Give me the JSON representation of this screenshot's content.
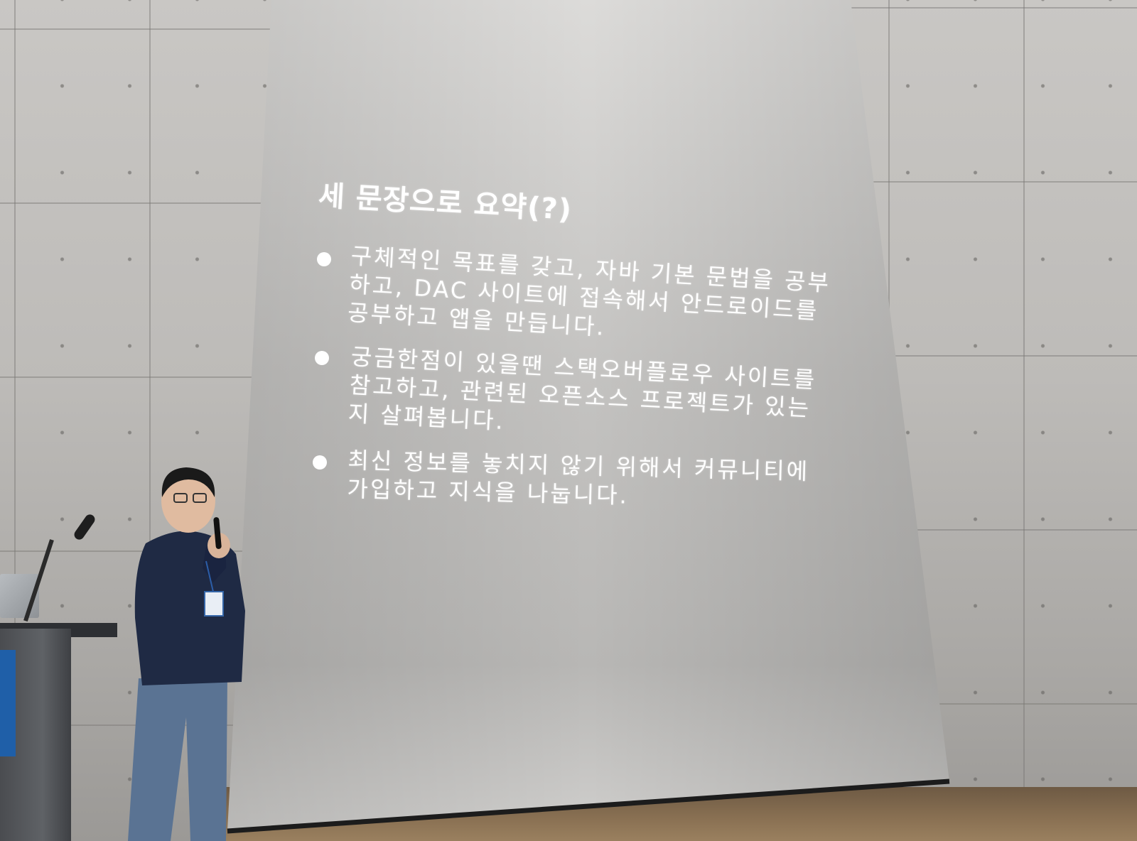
{
  "slide": {
    "title": "세 문장으로 요약(?)",
    "bullets": [
      {
        "lines": [
          "구체적인 목표를 갖고, 자바 기본 문법을 공부",
          "하고, DAC 사이트에 접속해서 안드로이드를",
          "공부하고 앱을 만듭니다."
        ]
      },
      {
        "lines": [
          "궁금한점이 있을땐 스택오버플로우 사이트를",
          "참고하고, 관련된 오픈소스 프로젝트가 있는",
          "지 살펴봅니다."
        ]
      },
      {
        "lines": [
          "최신 정보를 놓치지 않기 위해서 커뮤니티에",
          "가입하고 지식을 나눕니다."
        ]
      }
    ]
  },
  "colors": {
    "screen_light": "#d8d7d5",
    "screen_mid": "#a8a7a5",
    "text": "#ffffff",
    "jacket": "#1f2a44",
    "jeans": "#5a7393"
  }
}
